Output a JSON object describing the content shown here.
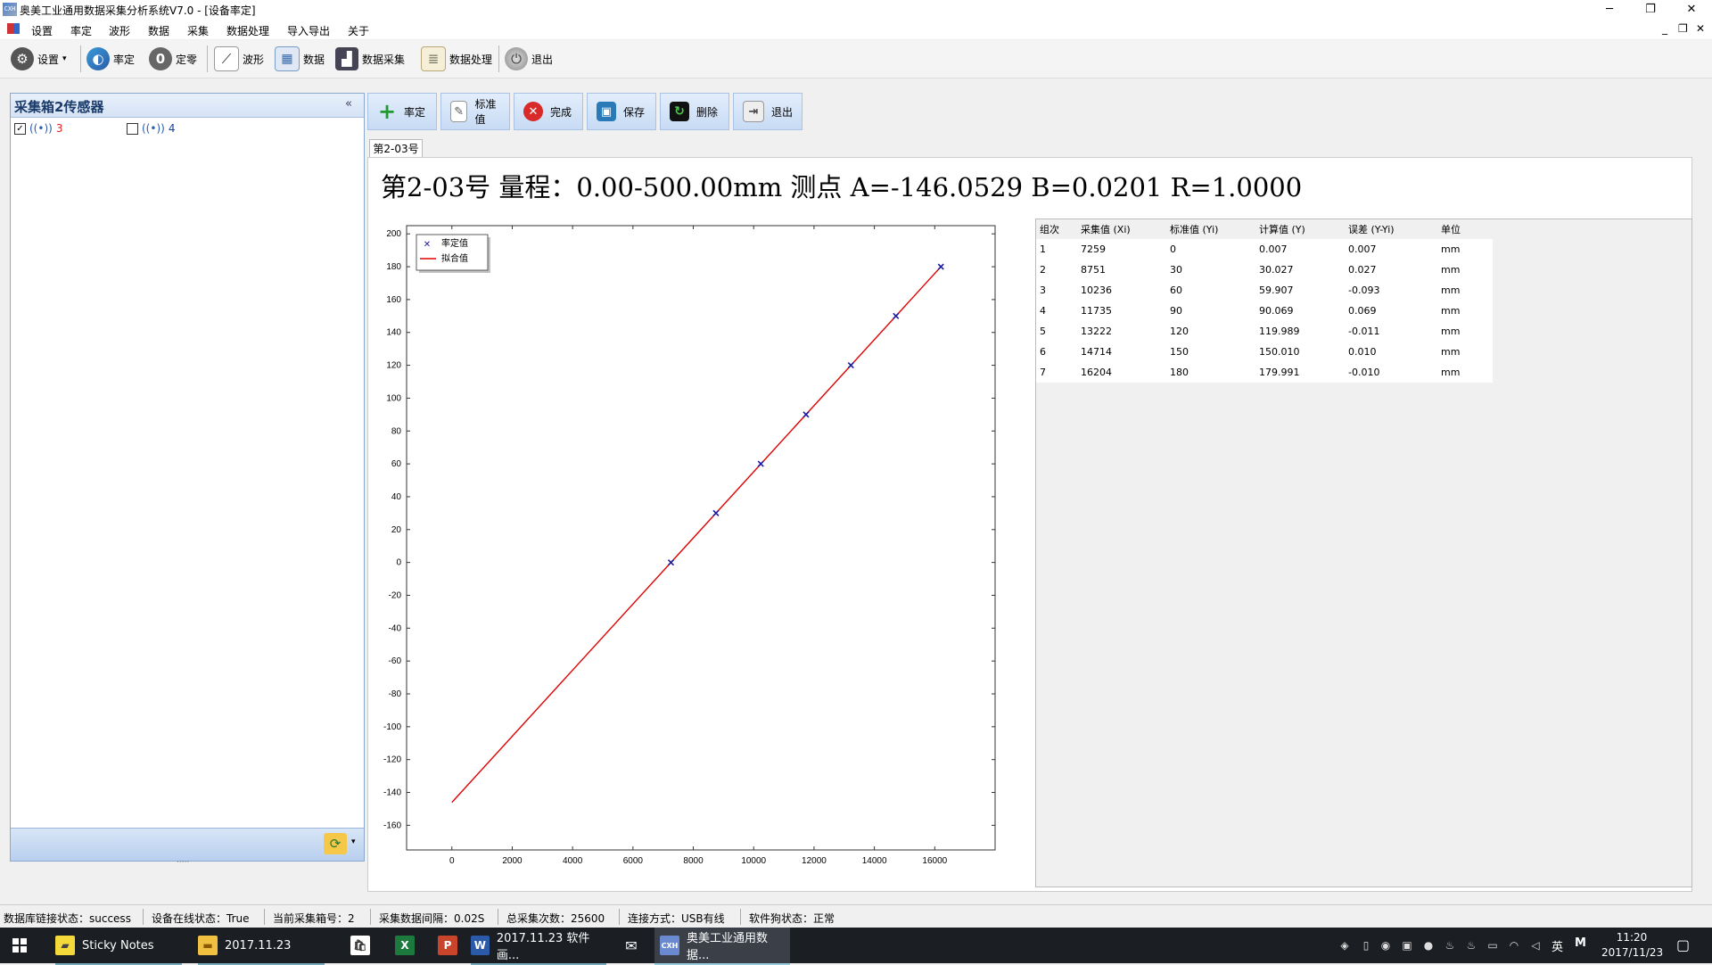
{
  "window": {
    "title": "奥美工业通用数据采集分析系统V7.0 - [设备率定]",
    "minimize": "─",
    "restore": "❐",
    "close": "✕",
    "mdi_minimize": "_",
    "mdi_restore": "❐",
    "mdi_close": "✕"
  },
  "menu": [
    "设置",
    "率定",
    "波形",
    "数据",
    "采集",
    "数据处理",
    "导入导出",
    "关于"
  ],
  "toolbar": {
    "settings": "设置",
    "calibrate": "率定",
    "zero": "定零",
    "waveform": "波形",
    "data": "数据",
    "acquisition": "数据采集",
    "processing": "数据处理",
    "exit": "退出"
  },
  "sidebar": {
    "title": "采集箱2传感器",
    "collapse": "«",
    "sensors": [
      {
        "label": "3",
        "checked": true,
        "color": "#e02020"
      },
      {
        "label": "4",
        "checked": false,
        "color": "#1a3ea8"
      }
    ],
    "grip": "·····",
    "refresh": "⟳",
    "dropdown": "▾"
  },
  "actions": {
    "calibrate": "率定",
    "standard": "标准值",
    "finish": "完成",
    "save": "保存",
    "delete": "删除",
    "exit": "退出"
  },
  "tab": "第2-03号",
  "heading": "第2-03号  量程：0.00-500.00mm  测点  A=-146.0529  B=0.0201  R=1.0000",
  "chart_data": {
    "type": "scatter",
    "title": "",
    "xlabel": "",
    "ylabel": "",
    "xlim": [
      -1500,
      18000
    ],
    "ylim": [
      -175,
      205
    ],
    "xticks": [
      0,
      2000,
      4000,
      6000,
      8000,
      10000,
      12000,
      14000,
      16000
    ],
    "yticks": [
      200,
      180,
      160,
      140,
      120,
      100,
      80,
      60,
      40,
      20,
      0,
      -20,
      -40,
      -60,
      -80,
      -100,
      -120,
      -140,
      -160
    ],
    "grid": false,
    "legend_position": "top-left",
    "series": [
      {
        "name": "率定值",
        "kind": "points",
        "marker": "x",
        "color": "#1a1aa0",
        "x": [
          7259,
          8751,
          10236,
          11735,
          13222,
          14714,
          16204
        ],
        "y": [
          0,
          30,
          60,
          90,
          120,
          150,
          180
        ]
      },
      {
        "name": "拟合值",
        "kind": "line",
        "color": "#e00000",
        "x": [
          0,
          16204
        ],
        "y": [
          -146.0529,
          179.991
        ]
      }
    ]
  },
  "table": {
    "headers": [
      "组次",
      "采集值 (Xi)",
      "标准值 (Yi)",
      "计算值 (Y)",
      "误差 (Y-Yi)",
      "单位"
    ],
    "rows": [
      [
        "1",
        "7259",
        "0",
        "0.007",
        "0.007",
        "mm"
      ],
      [
        "2",
        "8751",
        "30",
        "30.027",
        "0.027",
        "mm"
      ],
      [
        "3",
        "10236",
        "60",
        "59.907",
        "-0.093",
        "mm"
      ],
      [
        "4",
        "11735",
        "90",
        "90.069",
        "0.069",
        "mm"
      ],
      [
        "5",
        "13222",
        "120",
        "119.989",
        "-0.011",
        "mm"
      ],
      [
        "6",
        "14714",
        "150",
        "150.010",
        "0.010",
        "mm"
      ],
      [
        "7",
        "16204",
        "180",
        "179.991",
        "-0.010",
        "mm"
      ]
    ]
  },
  "status": [
    "数据库链接状态：success",
    "设备在线状态：True",
    "当前采集箱号：2",
    "采集数据间隔：0.02S",
    "总采集次数：25600",
    "连接方式：USB有线",
    "软件狗状态：正常"
  ],
  "taskbar": {
    "apps": [
      {
        "label": "Sticky Notes",
        "icon": "sticky-notes-icon"
      },
      {
        "label": "2017.11.23",
        "icon": "folder-icon"
      },
      {
        "label": "",
        "icon": "store-icon"
      },
      {
        "label": "",
        "icon": "excel-icon"
      },
      {
        "label": "",
        "icon": "powerpoint-icon"
      },
      {
        "label": "2017.11.23 软件画...",
        "icon": "word-icon"
      },
      {
        "label": "",
        "icon": "mail-icon"
      },
      {
        "label": "奥美工业通用数据...",
        "icon": "app-icon"
      }
    ],
    "ime": "英",
    "time": "11:20",
    "date": "2017/11/23"
  },
  "colors": {
    "accent": "#3a78c8",
    "fit_line": "#e00000",
    "points": "#1a1aa0"
  }
}
